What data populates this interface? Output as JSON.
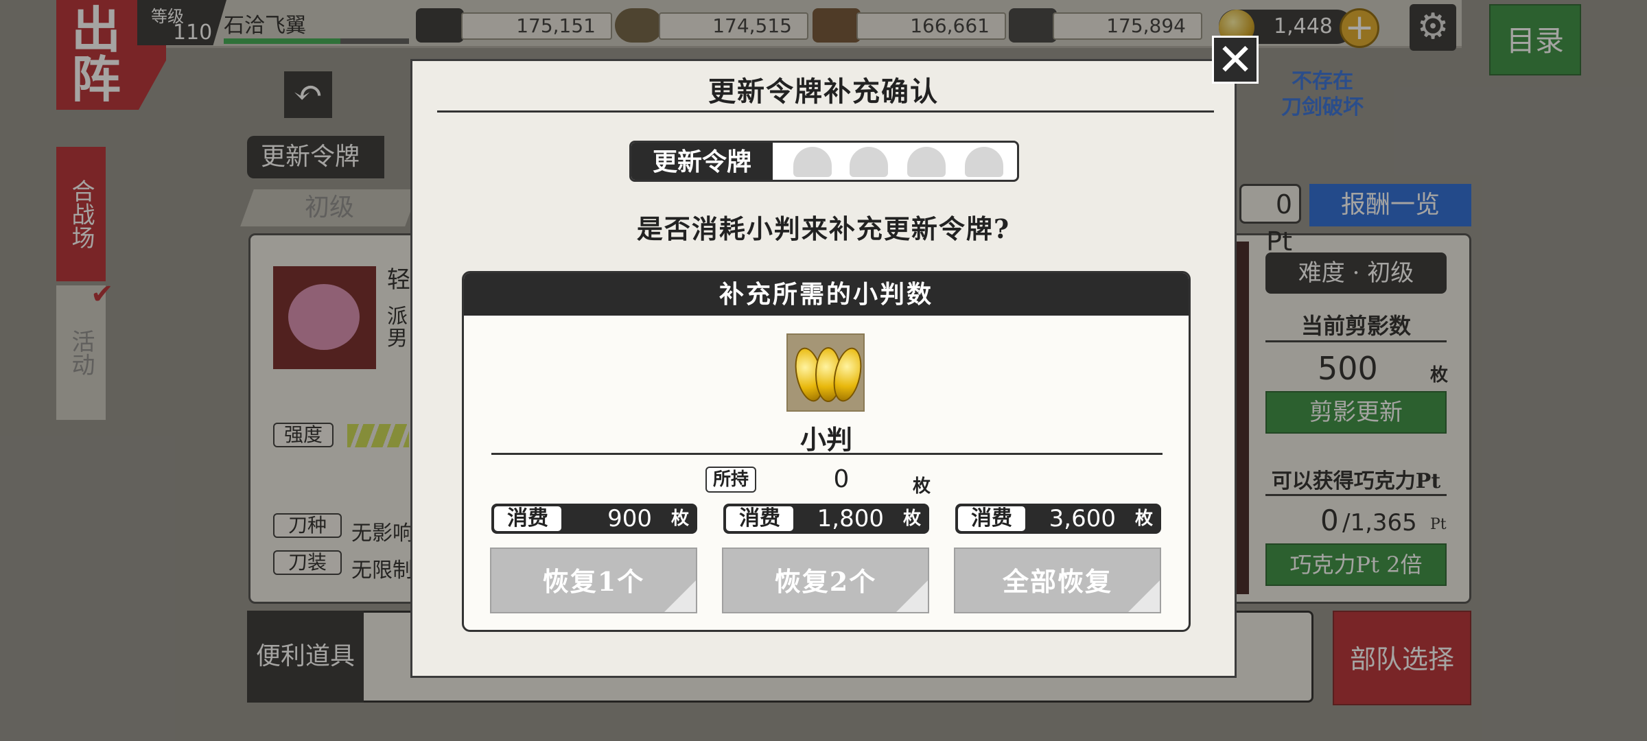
{
  "header": {
    "sortie": "出阵",
    "level_label": "等级",
    "level_value": "110",
    "player_name": "石洽飞翼",
    "resources": [
      {
        "name": "charcoal",
        "icon": "charcoal-icon",
        "value": "175,151"
      },
      {
        "name": "steel",
        "icon": "steel-icon",
        "value": "174,515"
      },
      {
        "name": "cooling-material",
        "icon": "coolant-icon",
        "value": "166,661"
      },
      {
        "name": "whetstone",
        "icon": "whetstone-icon",
        "value": "175,894"
      }
    ],
    "koban_count": "1,448",
    "menu_label": "目录"
  },
  "sidebar": {
    "tab_battlefield": "合战场",
    "tab_event": "活动"
  },
  "background": {
    "token_label": "更新令牌",
    "tab_beginner": "初级",
    "no_break_badge": "不存在\n刀剑破坏",
    "pt_value": "0",
    "pt_unit": "Pt",
    "rewards_button": "报酬一览",
    "difficulty": "难度 · 初级",
    "silhouette_label": "当前剪影数",
    "silhouette_value": "500",
    "silhouette_unit": "枚",
    "silhouette_refresh": "剪影更新",
    "choco_label": "可以获得巧克力Pt",
    "choco_current": "0",
    "choco_max": "1,365",
    "choco_unit": "Pt",
    "choco_double": "巧克力Pt 2倍",
    "strength_label": "强度",
    "blade_type_label": "刀种",
    "blade_type_value": "无影响",
    "equip_label": "刀装",
    "equip_value": "无限制",
    "item_label": "便利道具",
    "party_button": "部队选择",
    "char_name_partial": "轻",
    "char_line2": "派",
    "char_line3": "男"
  },
  "modal": {
    "title": "更新令牌补充确认",
    "token_label": "更新令牌",
    "question": "是否消耗小判来补充更新令牌?",
    "requirement_title": "补充所需的小判数",
    "item_name": "小判",
    "owned_label": "所持",
    "owned_value": "0",
    "unit": "枚",
    "costs": [
      {
        "label": "消费",
        "value": "900",
        "unit": "枚"
      },
      {
        "label": "消费",
        "value": "1,800",
        "unit": "枚"
      },
      {
        "label": "消费",
        "value": "3,600",
        "unit": "枚"
      }
    ],
    "buttons": [
      "恢复1个",
      "恢复2个",
      "全部恢复"
    ]
  },
  "colors": {
    "accent_red": "#b3252b",
    "accent_green": "#2f8b3a",
    "accent_blue": "#1f64d6",
    "dark": "#2b2b2b",
    "disabled_button": "#bdbdbd"
  }
}
